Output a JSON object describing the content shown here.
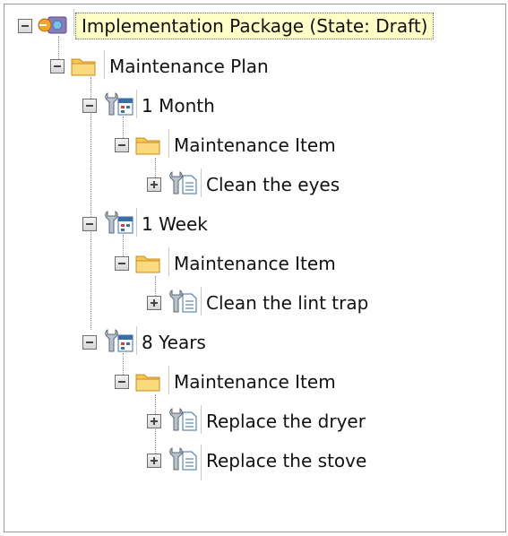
{
  "tree": {
    "root": {
      "label": "Implementation Package (State: Draft)",
      "icon": "package-icon",
      "expanded": true,
      "selected": true
    },
    "plan": {
      "label": "Maintenance Plan",
      "icon": "folder-icon",
      "expanded": true
    },
    "intervals": [
      {
        "label": "1 Month",
        "icon": "schedule-icon",
        "expanded": true,
        "group": {
          "label": "Maintenance Item",
          "icon": "folder-icon",
          "expanded": true
        },
        "items": [
          {
            "label": "Clean the eyes",
            "icon": "wrench-document-icon",
            "expanded": false
          }
        ]
      },
      {
        "label": "1 Week",
        "icon": "schedule-icon",
        "expanded": true,
        "group": {
          "label": "Maintenance Item",
          "icon": "folder-icon",
          "expanded": true
        },
        "items": [
          {
            "label": "Clean the lint trap",
            "icon": "wrench-document-icon",
            "expanded": false
          }
        ]
      },
      {
        "label": "8 Years",
        "icon": "schedule-icon",
        "expanded": true,
        "group": {
          "label": "Maintenance Item",
          "icon": "folder-icon",
          "expanded": true
        },
        "items": [
          {
            "label": "Replace the dryer",
            "icon": "wrench-document-icon",
            "expanded": false
          },
          {
            "label": "Replace the stove",
            "icon": "wrench-document-icon",
            "expanded": false
          }
        ]
      }
    ]
  }
}
